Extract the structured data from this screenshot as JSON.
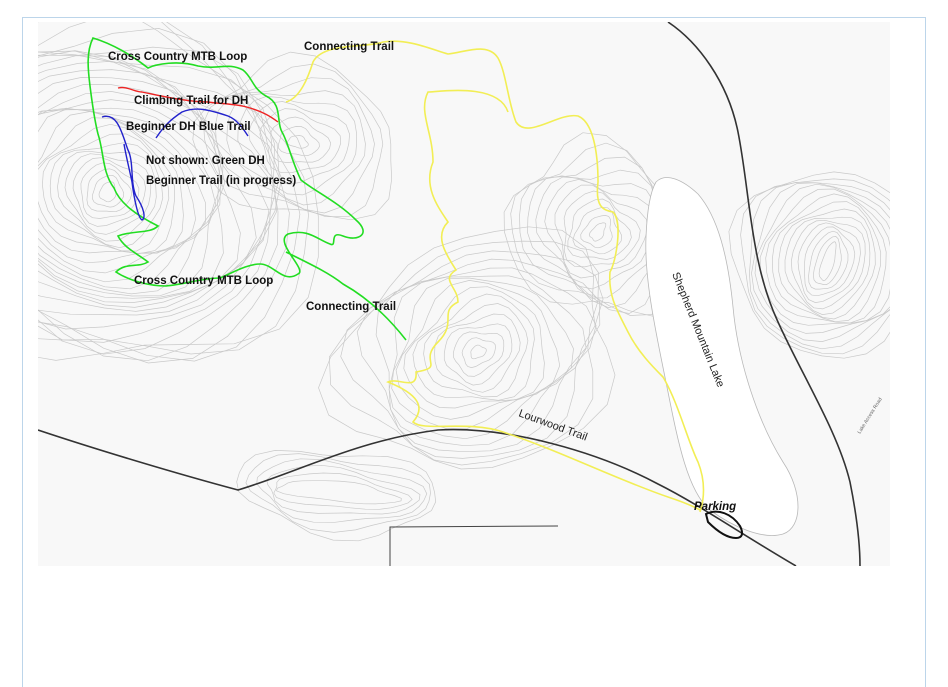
{
  "map": {
    "labels": {
      "xc_loop_top": "Cross Country MTB Loop",
      "climbing_trail": "Climbing Trail for DH",
      "beginner_blue": "Beginner DH Blue Trail",
      "not_shown_1": "Not shown: Green DH",
      "not_shown_2": "Beginner Trail (in progress)",
      "xc_loop_bottom": "Cross Country MTB Loop",
      "connecting_top": "Connecting Trail",
      "connecting_mid": "Connecting Trail",
      "lourwood": "Lourwood Trail",
      "lake": "Shepherd Mountain Lake",
      "parking": "Parking",
      "road_small": "Lake Access Road"
    },
    "colors": {
      "xc_loop": "#22dd22",
      "climbing": "#ee2222",
      "beginner_blue": "#2222cc",
      "connecting": "#f2ee55",
      "road": "#333333",
      "parking": "#111111",
      "lake": "#ffffff",
      "contour": "#c9c9c9"
    }
  }
}
